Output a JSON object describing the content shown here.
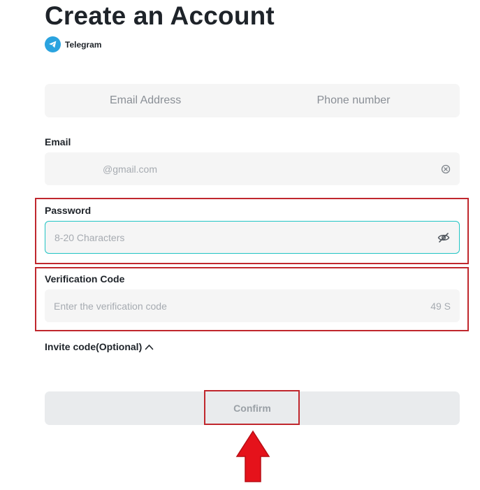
{
  "header": {
    "title": "Create an Account",
    "telegram_label": "Telegram"
  },
  "tabs": [
    {
      "label": "Email Address"
    },
    {
      "label": "Phone number"
    }
  ],
  "email": {
    "label": "Email",
    "value": "@gmail.com"
  },
  "password": {
    "label": "Password",
    "placeholder": "8-20 Characters"
  },
  "verification": {
    "label": "Verification Code",
    "placeholder": "Enter the verification code",
    "countdown": "49 S"
  },
  "invite": {
    "label": "Invite code(Optional)"
  },
  "confirm": {
    "label": "Confirm"
  },
  "colors": {
    "highlight": "#c0272d",
    "arrow": "#e5121b",
    "focus_border": "#21c4c4",
    "telegram": "#2aa3df"
  },
  "icons": {
    "telegram": "telegram-icon",
    "clear": "clear-icon",
    "password_toggle": "eye-slash-icon",
    "invite_toggle": "chevron-up-icon",
    "annotation": "arrow-up-icon"
  }
}
